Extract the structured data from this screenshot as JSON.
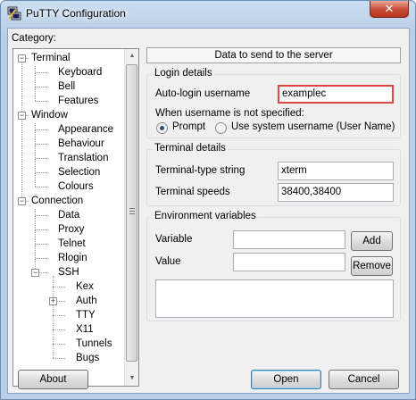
{
  "window": {
    "title": "PuTTY Configuration",
    "close_glyph": "✕",
    "icon": "putty-app-icon"
  },
  "category": {
    "label": "Category:",
    "items": [
      {
        "label": "Terminal",
        "level": 0,
        "expander": "−"
      },
      {
        "label": "Keyboard",
        "level": 1
      },
      {
        "label": "Bell",
        "level": 1
      },
      {
        "label": "Features",
        "level": 1
      },
      {
        "label": "Window",
        "level": 0,
        "expander": "−"
      },
      {
        "label": "Appearance",
        "level": 1
      },
      {
        "label": "Behaviour",
        "level": 1
      },
      {
        "label": "Translation",
        "level": 1
      },
      {
        "label": "Selection",
        "level": 1
      },
      {
        "label": "Colours",
        "level": 1
      },
      {
        "label": "Connection",
        "level": 0,
        "expander": "−"
      },
      {
        "label": "Data",
        "level": 1
      },
      {
        "label": "Proxy",
        "level": 1
      },
      {
        "label": "Telnet",
        "level": 1
      },
      {
        "label": "Rlogin",
        "level": 1
      },
      {
        "label": "SSH",
        "level": 1,
        "expander": "−"
      },
      {
        "label": "Kex",
        "level": 2
      },
      {
        "label": "Auth",
        "level": 2,
        "expander": "+"
      },
      {
        "label": "TTY",
        "level": 2
      },
      {
        "label": "X11",
        "level": 2
      },
      {
        "label": "Tunnels",
        "level": 2
      },
      {
        "label": "Bugs",
        "level": 2
      }
    ]
  },
  "panel": {
    "header": "Data to send to the server",
    "login": {
      "title": "Login details",
      "autologin_label": "Auto-login username",
      "autologin_value": "examplec",
      "unspecified_label": "When username is not specified:",
      "prompt_label": "Prompt",
      "system_label": "Use system username (User Name)",
      "selected": "prompt"
    },
    "terminal": {
      "title": "Terminal details",
      "type_label": "Terminal-type string",
      "type_value": "xterm",
      "speeds_label": "Terminal speeds",
      "speeds_value": "38400,38400"
    },
    "env": {
      "title": "Environment variables",
      "variable_label": "Variable",
      "variable_value": "",
      "value_label": "Value",
      "value_value": "",
      "add_label": "Add",
      "remove_label": "Remove"
    }
  },
  "footer": {
    "about": "About",
    "open": "Open",
    "cancel": "Cancel"
  },
  "colors": {
    "focus_border": "#e04848",
    "titlebar": "#b9cfe8",
    "close": "#c7503a"
  }
}
